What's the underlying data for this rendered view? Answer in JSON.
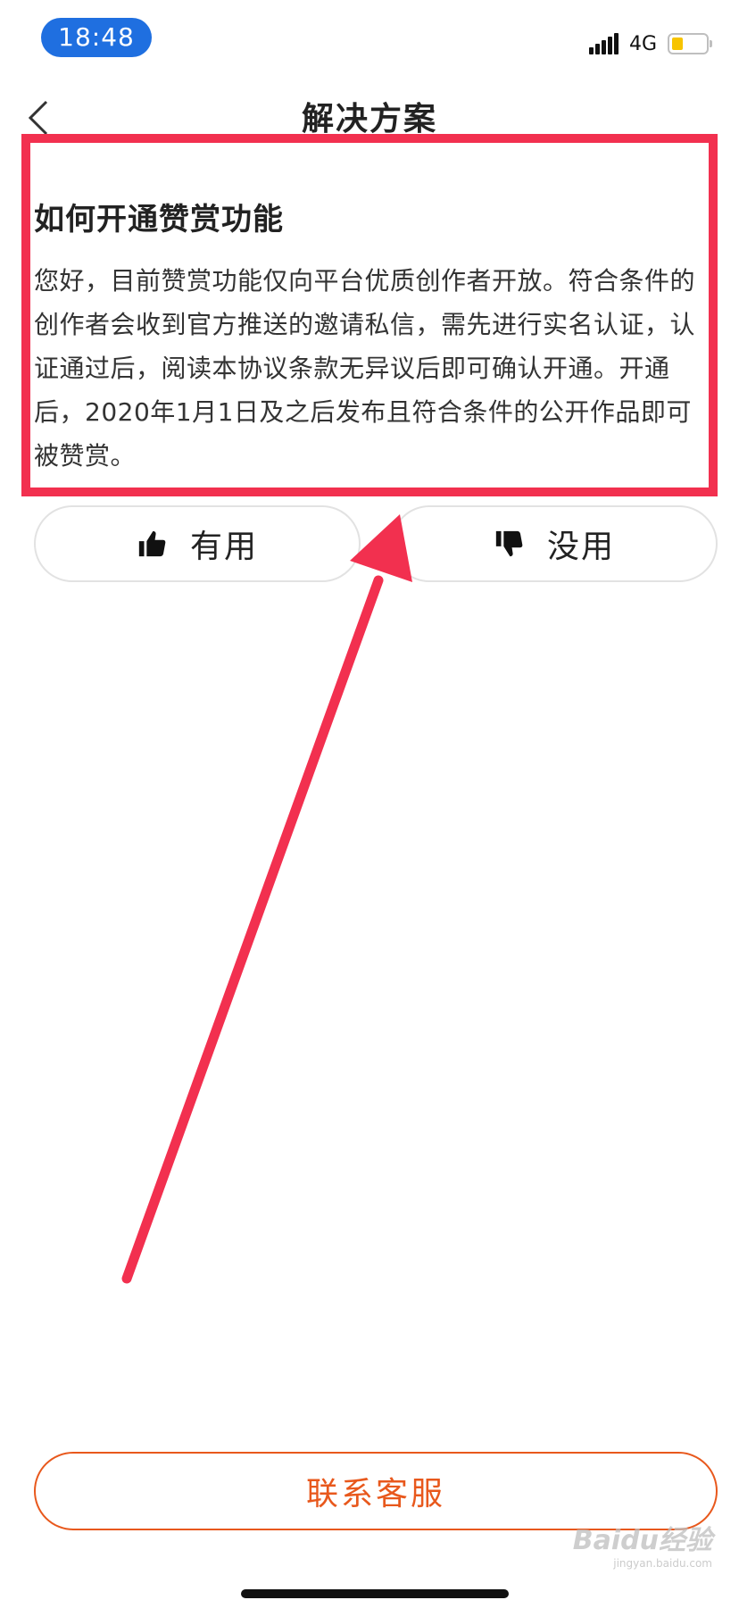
{
  "status_bar": {
    "time": "18:48",
    "network": "4G",
    "battery_level": 0.25,
    "battery_color": "#f7c400"
  },
  "nav": {
    "title": "解决方案",
    "back_icon": "chevron-left-icon"
  },
  "article": {
    "title": "如何开通赞赏功能",
    "body": "您好，目前赞赏功能仅向平台优质创作者开放。符合条件的创作者会收到官方推送的邀请私信，需先进行实名认证，认证通过后，阅读本协议条款无异议后即可确认开通。开通后，2020年1月1日及之后发布且符合条件的公开作品即可被赞赏。"
  },
  "feedback": {
    "useful_label": "有用",
    "useful_icon": "thumbs-up-icon",
    "useless_label": "没用",
    "useless_icon": "thumbs-down-icon"
  },
  "contact": {
    "label": "联系客服",
    "color": "#e8581c"
  },
  "annotation": {
    "color": "#f2304f"
  },
  "watermark": {
    "brand": "Baidu经验",
    "url": "jingyan.baidu.com"
  }
}
